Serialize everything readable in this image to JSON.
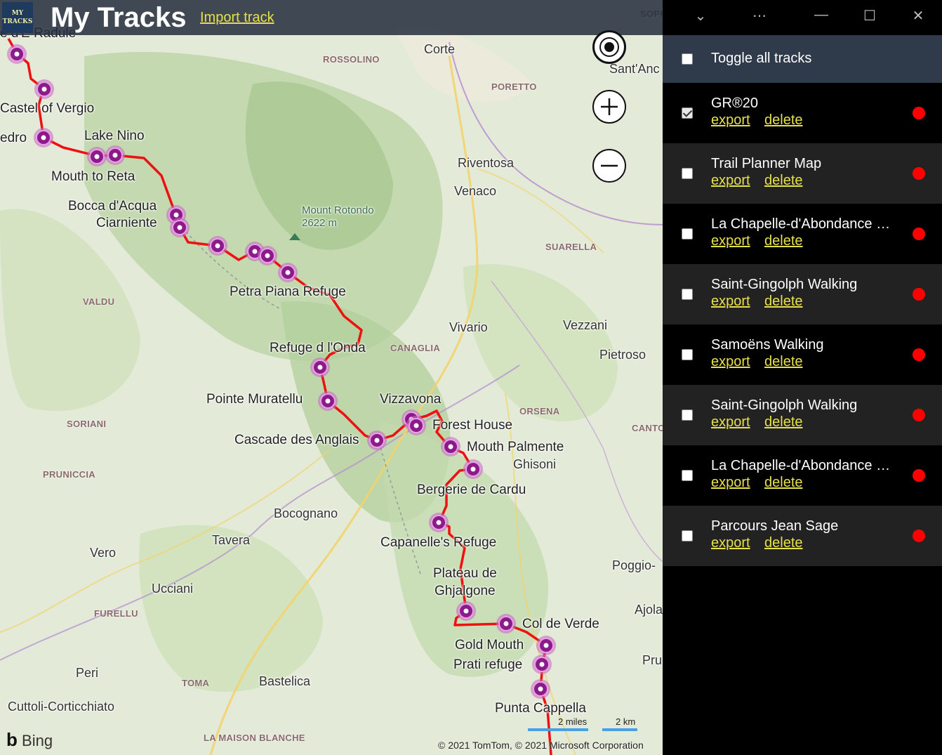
{
  "app": {
    "logo_text": "MY TRACKS",
    "title": "My Tracks",
    "import_label": "Import track"
  },
  "map": {
    "places": [
      {
        "name": "Corte"
      },
      {
        "name": "ROSSOLINO"
      },
      {
        "name": "PORETTO"
      },
      {
        "name": "Sant'Anc"
      },
      {
        "name": "Castel of Vergio"
      },
      {
        "name": "edro"
      },
      {
        "name": "Lake Nino"
      },
      {
        "name": "Mouth to Reta"
      },
      {
        "name": "Bocca d'Acqua"
      },
      {
        "name": "Ciarniente"
      },
      {
        "name": "Mount Rotondo"
      },
      {
        "name": "2622 m"
      },
      {
        "name": "Riventosa"
      },
      {
        "name": "Venaco"
      },
      {
        "name": "SUARELLA"
      },
      {
        "name": "Petra Piana Refuge"
      },
      {
        "name": "VALDU"
      },
      {
        "name": "Vivario"
      },
      {
        "name": "Vezzani"
      },
      {
        "name": "Pietroso"
      },
      {
        "name": "Refuge d l'Onda"
      },
      {
        "name": "CANAGLIA"
      },
      {
        "name": "Pointe Muratellu"
      },
      {
        "name": "Vizzavona"
      },
      {
        "name": "ORSENA"
      },
      {
        "name": "CANTO"
      },
      {
        "name": "Forest House"
      },
      {
        "name": "SORIANI"
      },
      {
        "name": "Cascade des Anglais"
      },
      {
        "name": "Mouth Palmente"
      },
      {
        "name": "Ghisoni"
      },
      {
        "name": "PRUNICCIA"
      },
      {
        "name": "Bergerie de Cardu"
      },
      {
        "name": "Bocognano"
      },
      {
        "name": "Tavera"
      },
      {
        "name": "Capanelle's Refuge"
      },
      {
        "name": "Vero"
      },
      {
        "name": "Plateau de"
      },
      {
        "name": "Ghjalgone"
      },
      {
        "name": "Poggio-"
      },
      {
        "name": "Ucciani"
      },
      {
        "name": "FURELLU"
      },
      {
        "name": "Ajola"
      },
      {
        "name": "Col de Verde"
      },
      {
        "name": "Gold Mouth"
      },
      {
        "name": "Prati refuge"
      },
      {
        "name": "Pru"
      },
      {
        "name": "Peri"
      },
      {
        "name": "TOMA"
      },
      {
        "name": "Bastelica"
      },
      {
        "name": "Punta Cappella"
      },
      {
        "name": "Cuttoli-Corticchiato"
      },
      {
        "name": "LA MAISON BLANCHE"
      },
      {
        "name": "SOPR"
      },
      {
        "name": "e d'E Radule"
      }
    ],
    "bing_label": "Bing",
    "copyright": "© 2021 TomTom, © 2021 Microsoft Corporation",
    "scale_miles": "2 miles",
    "scale_km": "2 km",
    "controls": {
      "locate": "target-icon",
      "zoom_in": "plus-icon",
      "zoom_out": "minus-icon"
    }
  },
  "titlebar": {
    "icons": [
      "chevron-down-icon",
      "more-icon",
      "minimize-icon",
      "maximize-icon",
      "close-icon"
    ],
    "glyphs": [
      "⌄",
      "⋯",
      "—",
      "☐",
      "✕"
    ]
  },
  "panel": {
    "toggle_label": "Toggle all tracks",
    "toggle_checked": false,
    "export_label": "export",
    "delete_label": "delete",
    "track_color": "#ff0000",
    "tracks": [
      {
        "name": "GR®20",
        "checked": true
      },
      {
        "name": "Trail Planner Map",
        "checked": false
      },
      {
        "name": "La Chapelle-d'Abondance Walking",
        "checked": false
      },
      {
        "name": "Saint-Gingolph Walking",
        "checked": false
      },
      {
        "name": "Samoëns Walking",
        "checked": false
      },
      {
        "name": "Saint-Gingolph Walking",
        "checked": false
      },
      {
        "name": "La Chapelle-d'Abondance Walking",
        "checked": false
      },
      {
        "name": "Parcours Jean Sage",
        "checked": false
      }
    ]
  }
}
